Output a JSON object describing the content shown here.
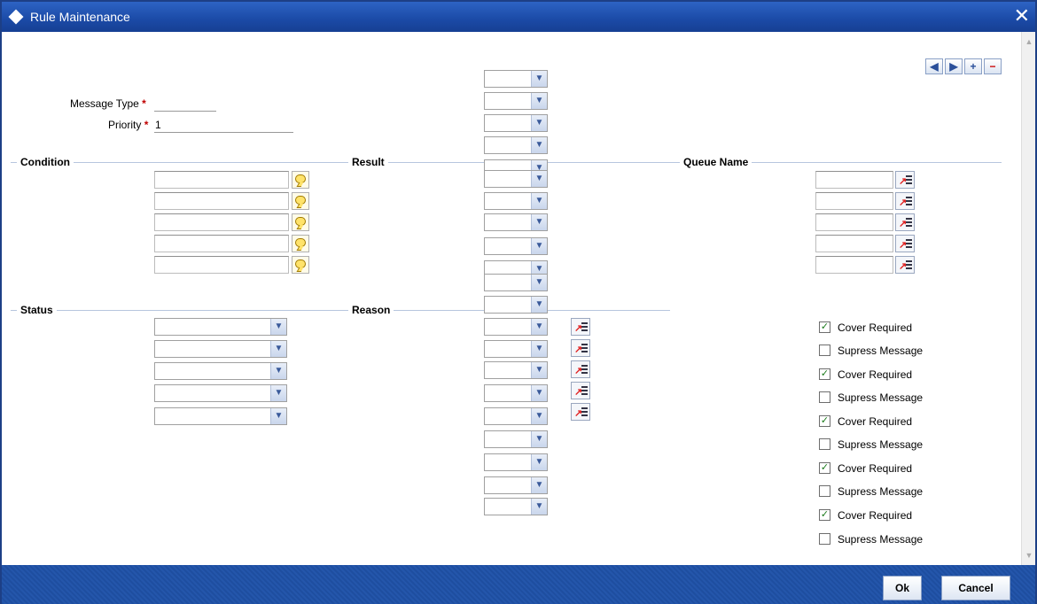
{
  "window": {
    "title": "Rule Maintenance",
    "close_glyph": "✕"
  },
  "header_fields": {
    "message_type": {
      "label": "Message Type",
      "required_mark": "*",
      "value": ""
    },
    "priority": {
      "label": "Priority",
      "required_mark": "*",
      "value": "1"
    }
  },
  "sections": {
    "condition": "Condition",
    "result": "Result",
    "queue_name": "Queue Name",
    "status": "Status",
    "reason": "Reason"
  },
  "nav_buttons": {
    "prev": "◀",
    "next": "▶",
    "add": "+",
    "remove": "−"
  },
  "checkboxes": [
    {
      "label": "Cover Required",
      "checked": true
    },
    {
      "label": "Supress Message",
      "checked": false
    },
    {
      "label": "Cover Required",
      "checked": true
    },
    {
      "label": "Supress Message",
      "checked": false
    },
    {
      "label": "Cover Required",
      "checked": true
    },
    {
      "label": "Supress Message",
      "checked": false
    },
    {
      "label": "Cover Required",
      "checked": true
    },
    {
      "label": "Supress Message",
      "checked": false
    },
    {
      "label": "Cover Required",
      "checked": true
    },
    {
      "label": "Supress Message",
      "checked": false
    }
  ],
  "footer": {
    "ok": "Ok",
    "cancel": "Cancel"
  },
  "icons": {
    "dropdown": "chevron-down-icon",
    "condition_builder": "speech-bubble-icon",
    "list_of_values": "lov-icon"
  }
}
